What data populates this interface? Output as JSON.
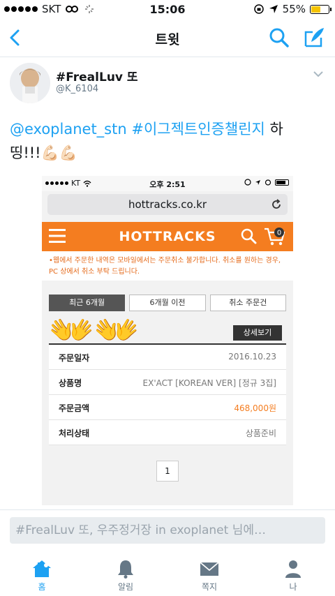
{
  "status_bar": {
    "carrier": "SKT",
    "time": "15:06",
    "battery": "55%",
    "battery_level": 0.55
  },
  "nav": {
    "title": "트윗"
  },
  "tweet": {
    "name": "#FrealLuv 또",
    "handle": "@K_6104",
    "mention": "@exoplanet_stn",
    "hashtag": "#이그젝트인증챌린지",
    "text_tail": " 하",
    "text_line2": "띵!!!",
    "emoji": "💪🏻💪🏻"
  },
  "embedded": {
    "status": {
      "carrier": "KT",
      "time": "오후 2:51"
    },
    "url": "hottracks.co.kr",
    "logo": "HOTTRACKS",
    "cart_count": "0",
    "notice": "•웹에서 주문한 내역은 모바일에서는 주문취소 불가합니다. 취소를 원하는 경우, PC 상에서 취소 부탁 드립니다.",
    "tabs": [
      "최근 6개월",
      "6개월 이전",
      "취소 주문건"
    ],
    "detail_button": "상세보기",
    "hands_emoji": "👐",
    "rows": [
      {
        "label": "주문일자",
        "value": "2016.10.23"
      },
      {
        "label": "상품명",
        "value": "EX'ACT [KOREAN VER] [정규 3집]"
      },
      {
        "label": "주문금액",
        "value": "468,000원"
      },
      {
        "label": "처리상태",
        "value": "상품준비"
      }
    ],
    "page": "1"
  },
  "reply": {
    "placeholder": "#FrealLuv 또, 우주정거장 in exoplanet 님에…"
  },
  "tabbar": {
    "home": "홈",
    "notifications": "알림",
    "messages": "쪽지",
    "me": "나"
  },
  "colors": {
    "twitter_blue": "#1da1f2",
    "hottracks_orange": "#f47d20"
  }
}
